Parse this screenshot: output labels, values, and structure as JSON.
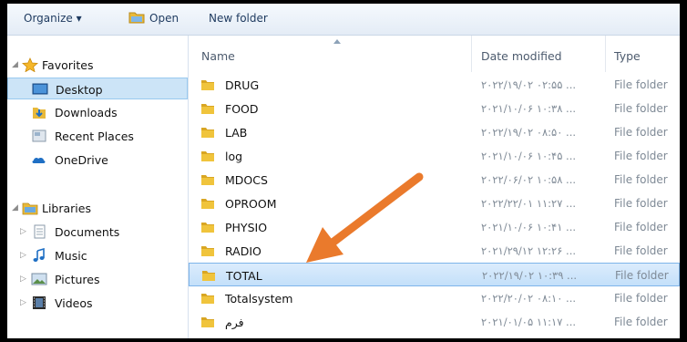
{
  "toolbar": {
    "organize_label": "Organize ▾",
    "open_label": "Open",
    "new_folder_label": "New folder"
  },
  "nav": {
    "favorites": {
      "label": "Favorites",
      "items": [
        {
          "label": "Desktop",
          "icon": "desktop-icon",
          "selected": true
        },
        {
          "label": "Downloads",
          "icon": "downloads-icon"
        },
        {
          "label": "Recent Places",
          "icon": "recent-places-icon"
        },
        {
          "label": "OneDrive",
          "icon": "onedrive-icon"
        }
      ]
    },
    "libraries": {
      "label": "Libraries",
      "items": [
        {
          "label": "Documents",
          "icon": "documents-icon"
        },
        {
          "label": "Music",
          "icon": "music-icon"
        },
        {
          "label": "Pictures",
          "icon": "pictures-icon"
        },
        {
          "label": "Videos",
          "icon": "videos-icon"
        }
      ]
    }
  },
  "columns": {
    "name": "Name",
    "date": "Date modified",
    "type": "Type"
  },
  "files": [
    {
      "name": "DRUG",
      "date": "۲۰۲۲/۱۹/۰۲ ۰۲:۵۵ ...",
      "type": "File folder"
    },
    {
      "name": "FOOD",
      "date": "۲۰۲۱/۱۰/۰۶ ۱۰:۳۸ ...",
      "type": "File folder"
    },
    {
      "name": "LAB",
      "date": "۲۰۲۲/۱۹/۰۲ ۰۸:۵۰ ...",
      "type": "File folder"
    },
    {
      "name": "log",
      "date": "۲۰۲۱/۱۰/۰۶ ۱۰:۴۵ ...",
      "type": "File folder"
    },
    {
      "name": "MDOCS",
      "date": "۲۰۲۲/۰۶/۰۲ ۱۰:۵۸ ...",
      "type": "File folder"
    },
    {
      "name": "OPROOM",
      "date": "۲۰۲۲/۲۲/۰۱ ۱۱:۲۷ ...",
      "type": "File folder"
    },
    {
      "name": "PHYSIO",
      "date": "۲۰۲۱/۱۰/۰۶ ۱۰:۴۱ ...",
      "type": "File folder"
    },
    {
      "name": "RADIO",
      "date": "۲۰۲۱/۲۹/۱۲ ۱۲:۲۶ ...",
      "type": "File folder"
    },
    {
      "name": "TOTAL",
      "date": "۲۰۲۲/۱۹/۰۲ ۱۰:۳۹ ...",
      "type": "File folder",
      "selected": true
    },
    {
      "name": "Totalsystem",
      "date": "۲۰۲۲/۲۰/۰۲ ۰۸:۱۰ ...",
      "type": "File folder"
    },
    {
      "name": "فرم",
      "date": "۲۰۲۱/۰۱/۰۵ ۱۱:۱۷ ...",
      "type": "File folder"
    }
  ],
  "colors": {
    "selection": "#cce4f7",
    "folder": "#f0c43c",
    "annotation_arrow": "#ea7a2c"
  }
}
